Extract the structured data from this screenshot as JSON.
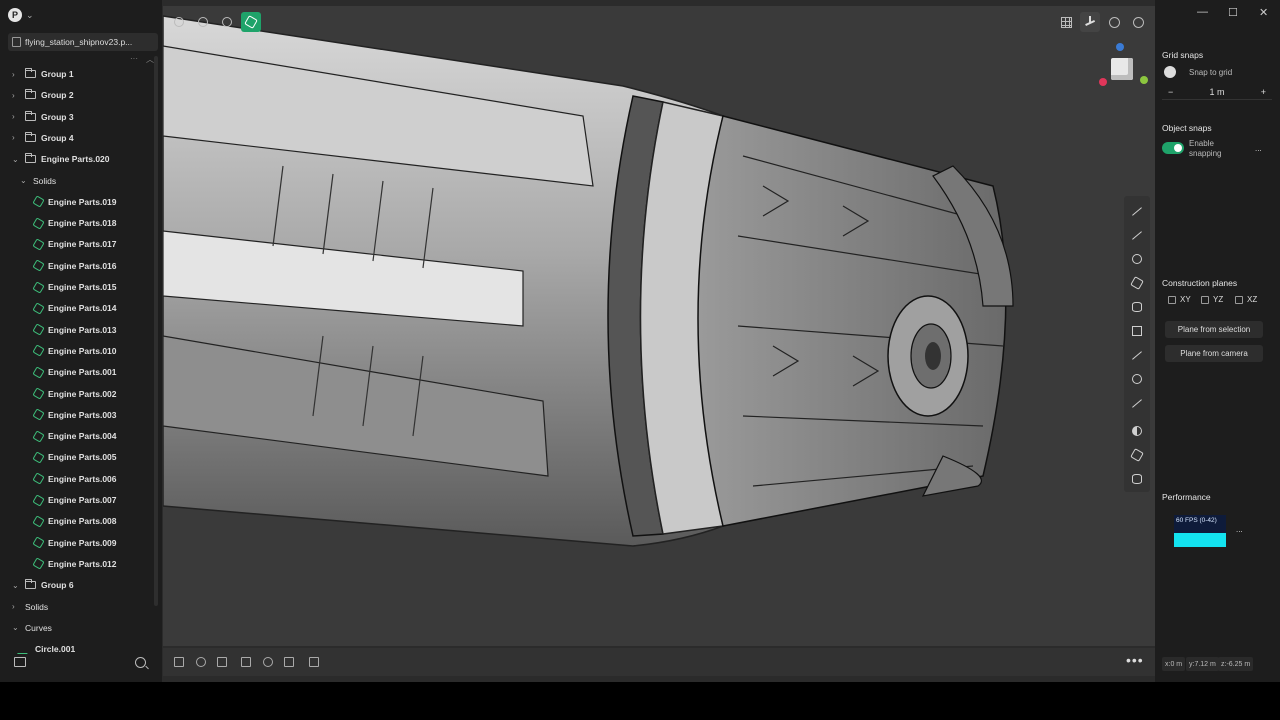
{
  "app": {
    "logo_letter": "P",
    "file_name": "flying_station_shipnov23.p..."
  },
  "tree": [
    {
      "label": "Group 1",
      "type": "group",
      "level": 0,
      "expanded": false
    },
    {
      "label": "Group 2",
      "type": "group",
      "level": 0,
      "expanded": false
    },
    {
      "label": "Group 3",
      "type": "group",
      "level": 0,
      "expanded": false
    },
    {
      "label": "Group 4",
      "type": "group",
      "level": 0,
      "expanded": false
    },
    {
      "label": "Engine Parts.020",
      "type": "group",
      "level": 0,
      "expanded": true
    },
    {
      "label": "Solids",
      "type": "section",
      "level": 1,
      "expanded": true
    },
    {
      "label": "Engine Parts.019",
      "type": "solid",
      "level": 2
    },
    {
      "label": "Engine Parts.018",
      "type": "solid",
      "level": 2
    },
    {
      "label": "Engine Parts.017",
      "type": "solid",
      "level": 2
    },
    {
      "label": "Engine Parts.016",
      "type": "solid",
      "level": 2
    },
    {
      "label": "Engine Parts.015",
      "type": "solid",
      "level": 2
    },
    {
      "label": "Engine Parts.014",
      "type": "solid",
      "level": 2
    },
    {
      "label": "Engine Parts.013",
      "type": "solid",
      "level": 2
    },
    {
      "label": "Engine Parts.010",
      "type": "solid",
      "level": 2
    },
    {
      "label": "Engine Parts.001",
      "type": "solid",
      "level": 2
    },
    {
      "label": "Engine Parts.002",
      "type": "solid",
      "level": 2
    },
    {
      "label": "Engine Parts.003",
      "type": "solid",
      "level": 2
    },
    {
      "label": "Engine Parts.004",
      "type": "solid",
      "level": 2
    },
    {
      "label": "Engine Parts.005",
      "type": "solid",
      "level": 2
    },
    {
      "label": "Engine Parts.006",
      "type": "solid",
      "level": 2
    },
    {
      "label": "Engine Parts.007",
      "type": "solid",
      "level": 2
    },
    {
      "label": "Engine Parts.008",
      "type": "solid",
      "level": 2
    },
    {
      "label": "Engine Parts.009",
      "type": "solid",
      "level": 2
    },
    {
      "label": "Engine Parts.012",
      "type": "solid",
      "level": 2
    },
    {
      "label": "Group 6",
      "type": "group",
      "level": 0,
      "expanded": true
    },
    {
      "label": "Solids",
      "type": "section",
      "level": 0,
      "expanded": false
    },
    {
      "label": "Curves",
      "type": "section",
      "level": 0,
      "expanded": true
    },
    {
      "label": "Circle.001",
      "type": "curve",
      "level": 1
    }
  ],
  "right_panel": {
    "grid_snaps_title": "Grid snaps",
    "snap_to_grid_label": "Snap to grid",
    "grid_size": "1 m",
    "minus": "−",
    "plus": "+",
    "object_snaps_title": "Object snaps",
    "enable_snapping_label": "Enable snapping",
    "more": "...",
    "construction_planes_title": "Construction planes",
    "planes": [
      "XY",
      "YZ",
      "XZ"
    ],
    "plane_from_selection": "Plane from selection",
    "plane_from_camera": "Plane from camera",
    "performance_title": "Performance",
    "fps_label": "60 FPS (0-42)"
  },
  "coords": {
    "x": "x:0 m",
    "y": "y:7.12 m",
    "z": "z:-6.25 m"
  },
  "window": {
    "minimize": "—",
    "maximize": "☐",
    "close": "✕"
  },
  "colors": {
    "accent": "#1fa36a",
    "solid_icon": "#3dbd7a",
    "perf_fill": "#13e3f0"
  }
}
